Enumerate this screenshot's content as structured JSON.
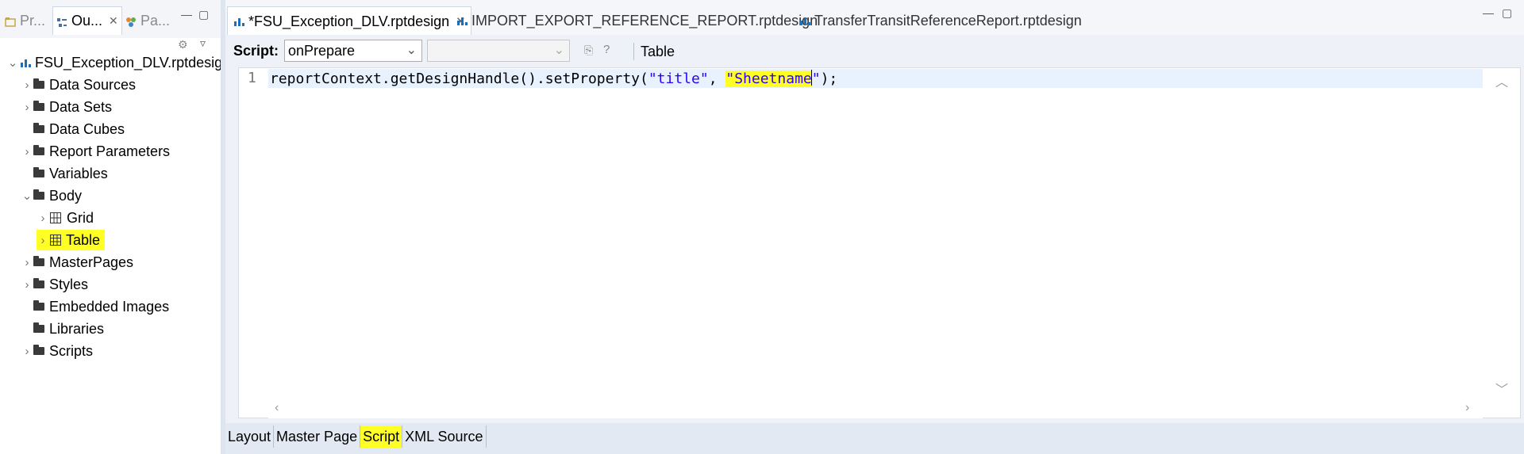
{
  "left_panel": {
    "tabs": [
      {
        "label": "Pr...",
        "icon": "project-icon"
      },
      {
        "label": "Ou...",
        "icon": "outline-icon",
        "active": true
      },
      {
        "label": "Pa...",
        "icon": "palette-icon"
      }
    ],
    "tree": {
      "root": "FSU_Exception_DLV.rptdesign",
      "items": [
        {
          "label": "Data Sources",
          "expandable": true
        },
        {
          "label": "Data Sets",
          "expandable": true
        },
        {
          "label": "Data Cubes",
          "expandable": false
        },
        {
          "label": "Report Parameters",
          "expandable": true
        },
        {
          "label": "Variables",
          "expandable": false
        },
        {
          "label": "Body",
          "expanded": true
        },
        {
          "label": "Grid",
          "child": true,
          "icon": "grid-icon"
        },
        {
          "label": "Table",
          "child": true,
          "icon": "table-icon",
          "highlighted": true
        },
        {
          "label": "MasterPages",
          "expandable": true
        },
        {
          "label": "Styles",
          "expandable": true
        },
        {
          "label": "Embedded Images",
          "expandable": false
        },
        {
          "label": "Libraries",
          "expandable": false
        },
        {
          "label": "Scripts",
          "expandable": true
        }
      ]
    }
  },
  "editor": {
    "tabs": [
      {
        "label": "*FSU_Exception_DLV.rptdesign",
        "active": true,
        "closable": true
      },
      {
        "label": "IMPORT_EXPORT_REFERENCE_REPORT.rptdesign"
      },
      {
        "label": "TransferTransitReferenceReport.rptdesign"
      }
    ],
    "script_label": "Script:",
    "event_combo": "onPrepare",
    "method_combo": "",
    "context_label": "Table",
    "code": {
      "line_number": "1",
      "prefix": "reportContext.getDesignHandle().setProperty(",
      "arg1": "\"title\"",
      "sep": ", ",
      "arg2_text": "\"Sheetname",
      "arg2_end": "\"",
      "suffix": ");"
    },
    "bottom_tabs": [
      "Layout",
      "Master Page",
      "Script",
      "XML Source"
    ],
    "active_bottom_tab": "Script"
  },
  "colors": {
    "highlight": "#ffff26",
    "string": "#2a00ff",
    "folder": "#3a3a3a",
    "report_icon": "#1e6fb8"
  }
}
